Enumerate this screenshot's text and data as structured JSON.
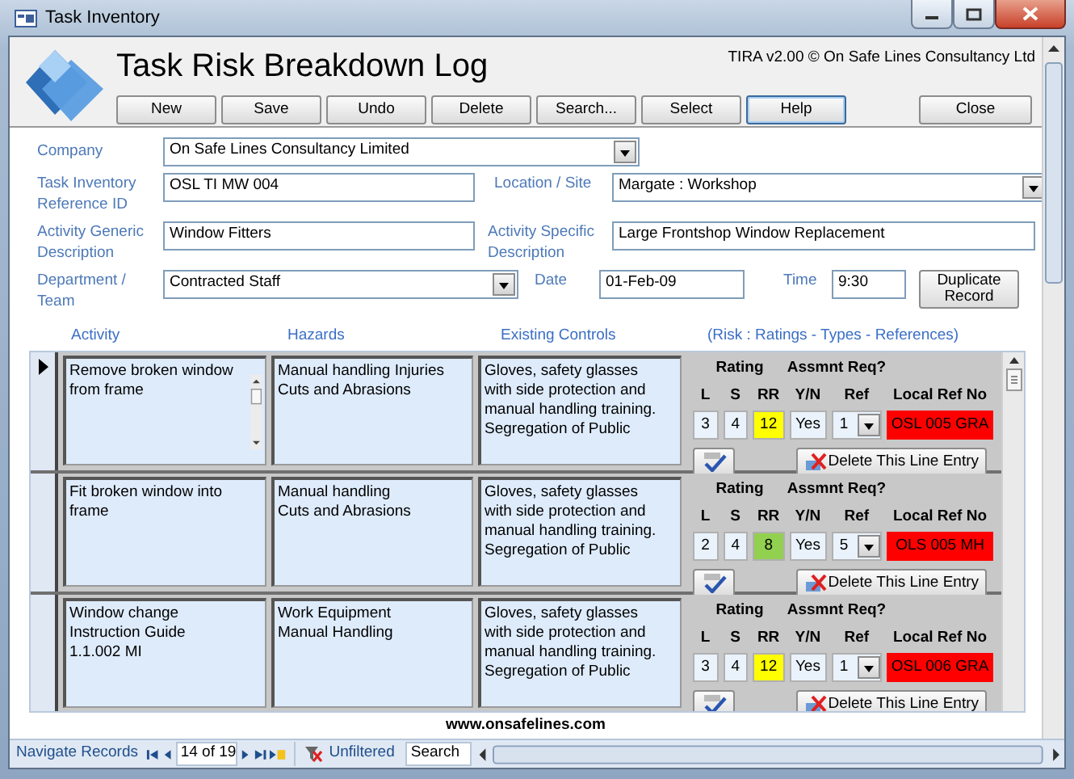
{
  "window": {
    "title": "Task Inventory"
  },
  "header": {
    "title": "Task Risk Breakdown Log",
    "copyright": "TIRA v2.00 © On Safe Lines Consultancy Ltd"
  },
  "toolbar": [
    {
      "label": "New"
    },
    {
      "label": "Save"
    },
    {
      "label": "Undo"
    },
    {
      "label": "Delete"
    },
    {
      "label": "Search..."
    },
    {
      "label": "Select"
    },
    {
      "label": "Help"
    }
  ],
  "close_button": "Close",
  "form": {
    "company": {
      "label": "Company",
      "value": "On Safe Lines Consultancy Limited"
    },
    "reference_id": {
      "label": "Task Inventory Reference ID",
      "value": "OSL TI MW 004"
    },
    "location": {
      "label": "Location / Site",
      "value": "Margate : Workshop"
    },
    "generic_description": {
      "label": "Activity Generic Description",
      "value": "Window Fitters"
    },
    "specific_description": {
      "label": "Activity Specific Description",
      "value": "Large Frontshop Window Replacement"
    },
    "department": {
      "label": "Department / Team",
      "value": "Contracted Staff"
    },
    "date": {
      "label": "Date",
      "value": "01-Feb-09"
    },
    "time": {
      "label": "Time",
      "value": "9:30"
    },
    "duplicate_button": "Duplicate Record"
  },
  "columns": [
    "Activity",
    "Hazards",
    "Existing Controls",
    "(Risk : Ratings - Types - References)"
  ],
  "records": [
    {
      "selected": true,
      "activity": "Remove broken window from frame",
      "hazards": "Manual handling Injuries\nCuts and Abrasions",
      "controls": "Gloves, safety glasses\nwith side protection and\nmanual handling training.\nSegregation of Public",
      "labels": {
        "rating": "Rating",
        "assessment": "Assmnt Req?",
        "l": "L",
        "s": "S",
        "rr": "RR",
        "yn": "Y/N",
        "ref": "Ref",
        "local_ref": "Local Ref No"
      },
      "l": "3",
      "s": "4",
      "rr": "12",
      "color": "#ffff00",
      "yn": "Yes",
      "ref": "1",
      "local_ref": "OSL 005 GRA",
      "delete_button": "Delete This Line Entry"
    },
    {
      "selected": false,
      "activity": "Fit broken window into frame",
      "hazards": "Manual handling\nCuts and Abrasions",
      "controls": "Gloves, safety glasses\nwith side protection and\nmanual handling training.\nSegregation of Public",
      "labels": {
        "rating": "Rating",
        "assessment": "Assmnt Req?",
        "l": "L",
        "s": "S",
        "rr": "RR",
        "yn": "Y/N",
        "ref": "Ref",
        "local_ref": "Local Ref No"
      },
      "l": "2",
      "s": "4",
      "rr": "8",
      "color": "#92d050",
      "yn": "Yes",
      "ref": "5",
      "local_ref": "OLS 005 MH",
      "delete_button": "Delete This Line Entry"
    },
    {
      "selected": false,
      "activity": "Window change\nInstruction Guide\n1.1.002 MI",
      "hazards": "Work Equipment\nManual Handling",
      "controls": "Gloves, safety glasses\nwith side protection and\nmanual handling training.\nSegregation of Public",
      "labels": {
        "rating": "Rating",
        "assessment": "Assmnt Req?",
        "l": "L",
        "s": "S",
        "rr": "RR",
        "yn": "Y/N",
        "ref": "Ref",
        "local_ref": "Local Ref No"
      },
      "l": "3",
      "s": "4",
      "rr": "12",
      "color": "#ffff00",
      "yn": "Yes",
      "ref": "1",
      "local_ref": "OSL 006 GRA",
      "delete_button": "Delete This Line Entry"
    }
  ],
  "footer_link": "www.onsafelines.com",
  "navigation": {
    "label": "Navigate Records",
    "position": "14 of 19",
    "filter": "Unfiltered",
    "search": "Search"
  }
}
